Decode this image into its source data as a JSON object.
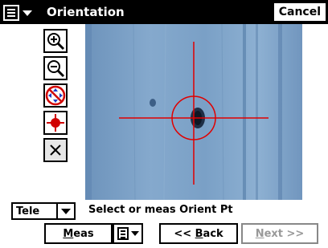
{
  "window": {
    "title": "Orientation",
    "cancel_label": "Cancel"
  },
  "tools": [
    {
      "icon": "zoom-in-icon"
    },
    {
      "icon": "zoom-out-icon"
    },
    {
      "icon": "pan-icon"
    },
    {
      "icon": "target-icon"
    },
    {
      "icon": "close-icon"
    }
  ],
  "controls": {
    "zoom_mode": "Tele",
    "status_text": "Select or meas Orient Pt",
    "meas_label": "Meas",
    "back_label": "<< Back",
    "next_label": "Next >>",
    "next_enabled": false
  },
  "colors": {
    "crosshair": "#e00000",
    "camera_bg": "#7fa4c8"
  }
}
